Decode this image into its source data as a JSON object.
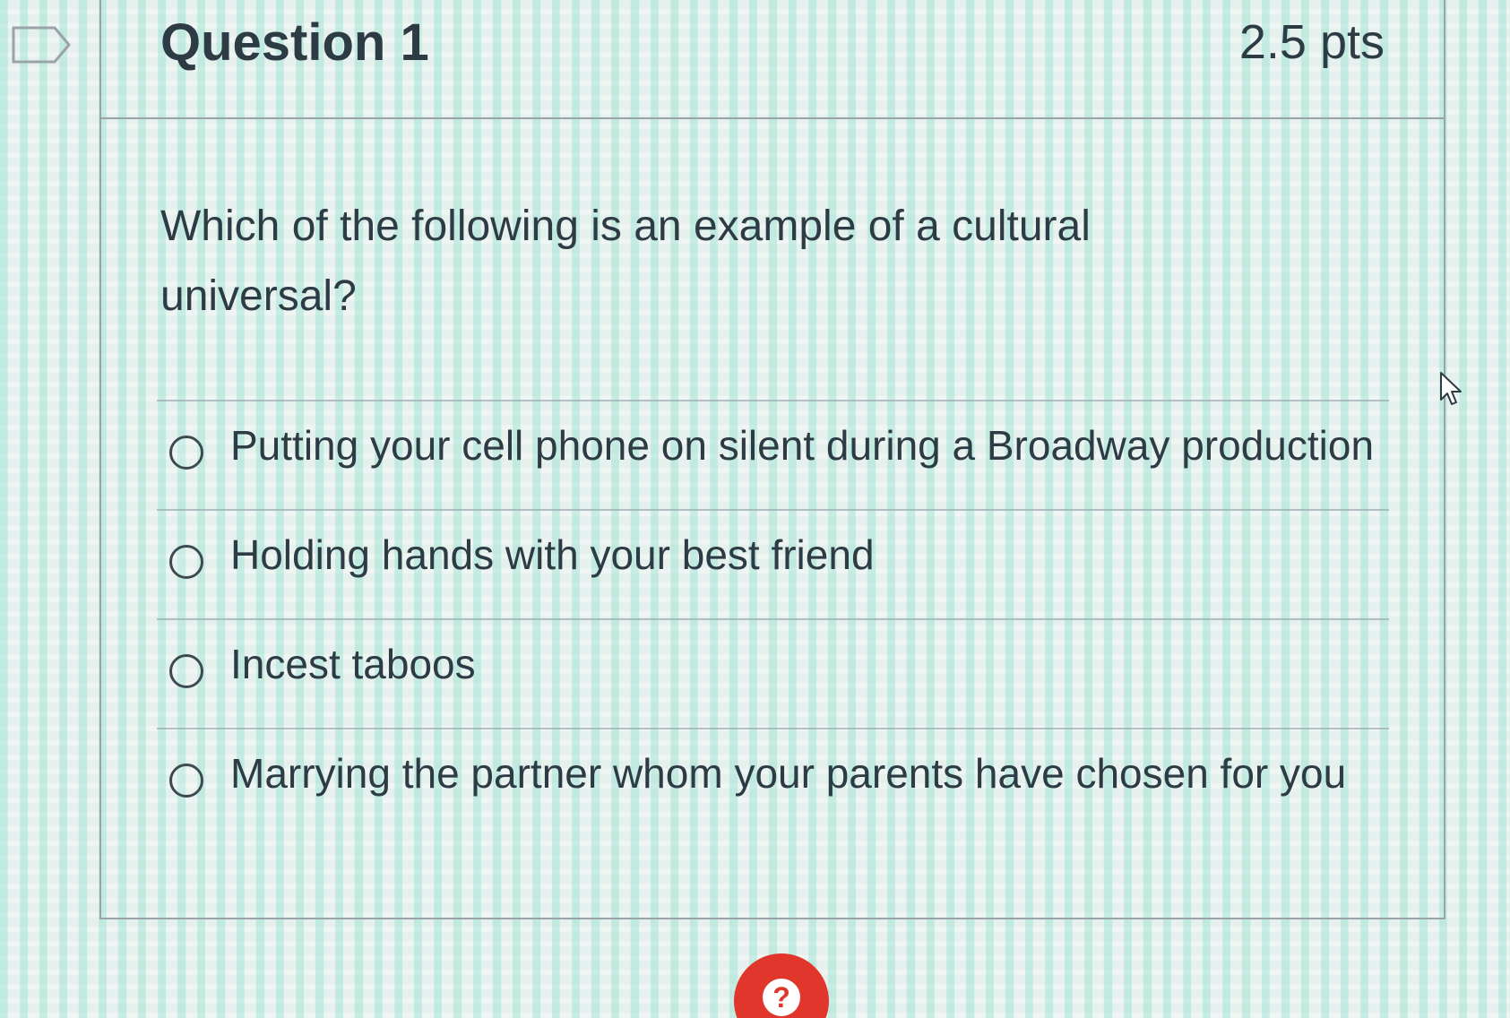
{
  "question": {
    "title": "Question 1",
    "points": "2.5 pts",
    "text": "Which of the following is an example of a cultural universal?"
  },
  "answers": [
    {
      "label": "Putting your cell phone on silent during a Broadway production",
      "selected": false
    },
    {
      "label": "Holding hands with your best friend",
      "selected": false
    },
    {
      "label": "Incest taboos",
      "selected": false
    },
    {
      "label": "Marrying the partner whom your parents have chosen for you",
      "selected": false
    }
  ],
  "help": {
    "glyph": "?",
    "color": "#e0362b"
  },
  "icons": {
    "flag": "bookmark-flag-icon",
    "cursor": "mouse-pointer-icon",
    "help": "help-icon"
  },
  "colors": {
    "text": "#2d3b45",
    "border": "#9aa3a8",
    "accent": "#e0362b"
  }
}
